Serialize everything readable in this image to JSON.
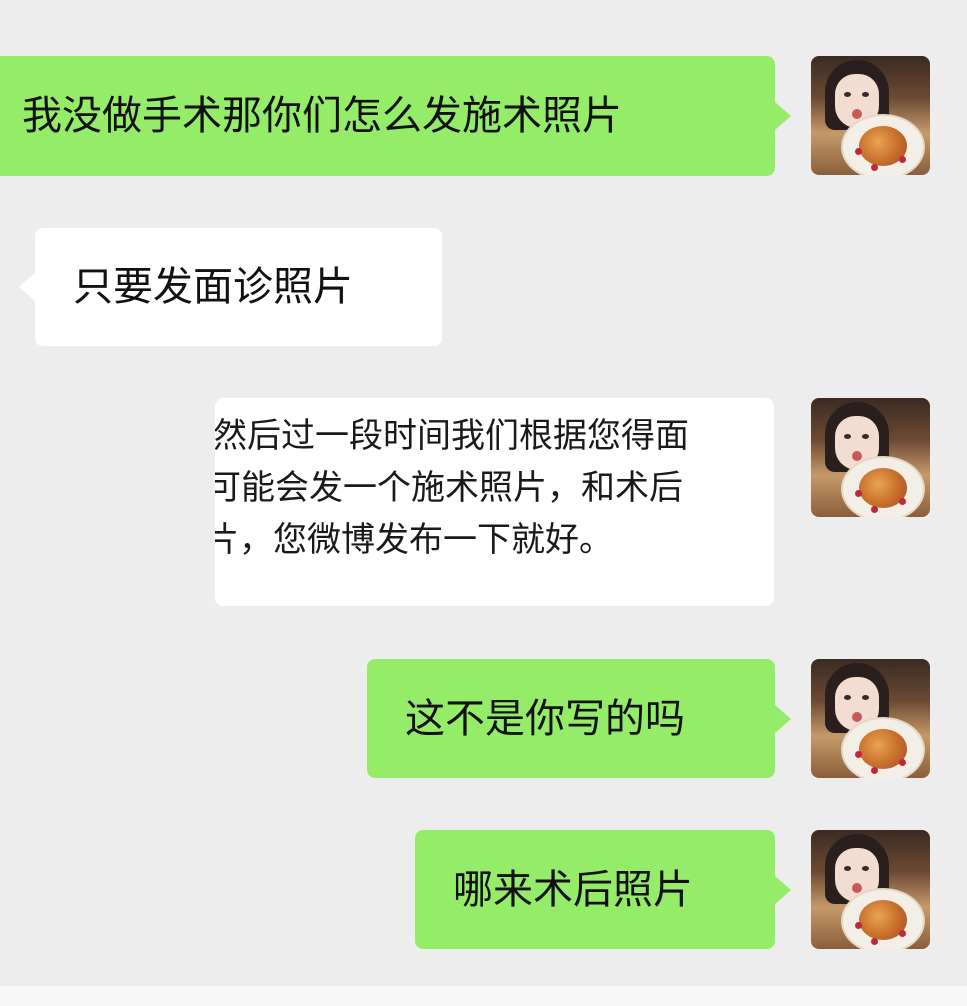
{
  "messages": [
    {
      "id": "m1",
      "side": "sent",
      "text": "我没做手术那你们怎么发施术照片"
    },
    {
      "id": "m2",
      "side": "received",
      "text": "只要发面诊照片"
    },
    {
      "id": "m3",
      "side": "sent",
      "type": "image",
      "lines": [
        "然后过一段时间我们根据您得面",
        "可能会发一个施术照片，和术后",
        "片，您微博发布一下就好。"
      ]
    },
    {
      "id": "m4",
      "side": "sent",
      "text": "这不是你写的吗"
    },
    {
      "id": "m5",
      "side": "sent",
      "text": "哪来术后照片"
    }
  ],
  "colors": {
    "background": "#ededed",
    "sent_bubble": "#95ec69",
    "received_bubble": "#ffffff"
  },
  "icons": {
    "avatar": "user-avatar-photo"
  }
}
